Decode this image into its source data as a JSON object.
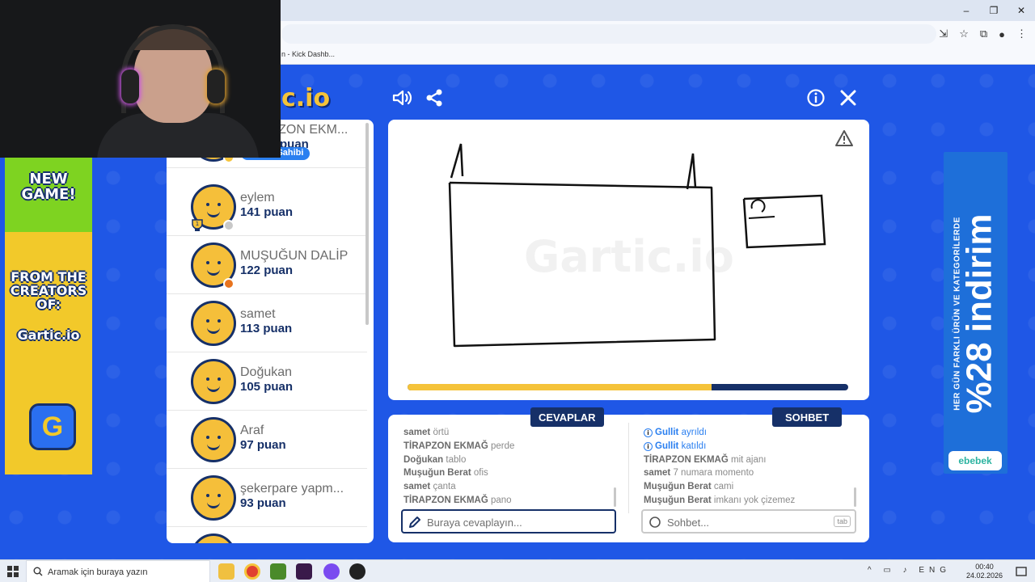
{
  "browser": {
    "bookmark_text": "n - Kick Dashb...",
    "window_controls": [
      "–",
      "❐",
      "✕"
    ],
    "toolbar_icons": [
      "install-icon",
      "star-icon",
      "extensions-icon",
      "profile-icon",
      "menu-icon"
    ]
  },
  "logo": {
    "text": "c.io"
  },
  "left_ad": {
    "headline": "NEW GAME!",
    "from": "FROM THE CREATORS OF:",
    "brand": "Gartic.io",
    "app_letter": "G"
  },
  "right_ad": {
    "small_text": "HER GÜN FARKLI ÜRÜN VE KATEGORİLERDE",
    "big_text": "%28 indirim",
    "brand": "ebebek"
  },
  "players": [
    {
      "name": "TİRAPZON EKM...",
      "score": "puan",
      "badge": "Oda Sahibi",
      "dot": "#f5c33a"
    },
    {
      "name": "eylem",
      "score": "141 puan",
      "dot": "#c8c8c8",
      "trophy": "1"
    },
    {
      "name": "MUŞUĞUN DALİP",
      "score": "122 puan",
      "dot": "#e8741e"
    },
    {
      "name": "samet",
      "score": "113 puan"
    },
    {
      "name": "Doğukan",
      "score": "105 puan"
    },
    {
      "name": "Araf",
      "score": "97 puan"
    },
    {
      "name": "şekerpare yapm...",
      "score": "93 puan"
    }
  ],
  "canvas": {
    "watermark": "Gartic.io",
    "progress": 0.69
  },
  "answers": {
    "label": "CEVAPLAR",
    "messages": [
      {
        "user": "samet",
        "text": "örtü"
      },
      {
        "user": "TİRAPZON EKMAĞ",
        "text": "perde"
      },
      {
        "user": "Doğukan",
        "text": "tablo"
      },
      {
        "user": "Muşuğun Berat",
        "text": "ofis"
      },
      {
        "user": "samet",
        "text": "çanta"
      },
      {
        "user": "TİRAPZON EKMAĞ",
        "text": "pano"
      }
    ],
    "placeholder": "Buraya cevaplayın..."
  },
  "chat": {
    "label": "SOHBET",
    "system": [
      {
        "user": "Gullit",
        "text": "ayrıldı"
      },
      {
        "user": "Gullit",
        "text": "katıldı"
      }
    ],
    "messages": [
      {
        "user": "TİRAPZON EKMAĞ",
        "text": "mit ajanı"
      },
      {
        "user": "samet",
        "text": "7 numara momento"
      },
      {
        "user": "Muşuğun Berat",
        "text": "cami"
      },
      {
        "user": "Muşuğun Berat",
        "text": "imkanı yok çizemez"
      }
    ],
    "placeholder": "Sohbet...",
    "tab_key": "tab"
  },
  "taskbar": {
    "search_placeholder": "Aramak için buraya yazın",
    "time": "00:40",
    "date": "24.02.2026"
  }
}
